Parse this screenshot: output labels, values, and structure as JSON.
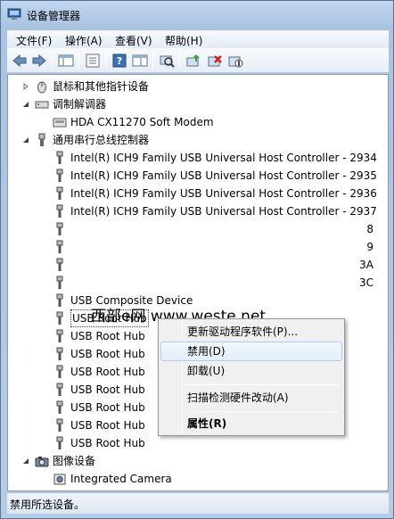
{
  "window": {
    "title": "设备管理器"
  },
  "menu": [
    "文件(F)",
    "操作(A)",
    "查看(V)",
    "帮助(H)"
  ],
  "tree": [
    {
      "label": "鼠标和其他指针设备",
      "expand": "collapsed",
      "indent": 0,
      "icon": "mouse-icon"
    },
    {
      "label": "调制解调器",
      "expand": "expanded",
      "indent": 0,
      "icon": "modem-icon"
    },
    {
      "label": "HDA CX11270 Soft Modem",
      "expand": "none",
      "indent": 1,
      "icon": "modem-device-icon"
    },
    {
      "label": "通用串行总线控制器",
      "expand": "expanded",
      "indent": 0,
      "icon": "usb-controller-icon"
    },
    {
      "label": "Intel(R) ICH9 Family USB Universal Host Controller - 2934",
      "expand": "none",
      "indent": 1,
      "icon": "usb-plug-icon"
    },
    {
      "label": "Intel(R) ICH9 Family USB Universal Host Controller - 2935",
      "expand": "none",
      "indent": 1,
      "icon": "usb-plug-icon"
    },
    {
      "label": "Intel(R) ICH9 Family USB Universal Host Controller - 2936",
      "expand": "none",
      "indent": 1,
      "icon": "usb-plug-icon"
    },
    {
      "label": "Intel(R) ICH9 Family USB Universal Host Controller - 2937",
      "expand": "none",
      "indent": 1,
      "icon": "usb-plug-icon"
    },
    {
      "label": "8",
      "expand": "none",
      "indent": 1,
      "icon": "usb-plug-icon",
      "tail": true
    },
    {
      "label": "9",
      "expand": "none",
      "indent": 1,
      "icon": "usb-plug-icon",
      "tail": true
    },
    {
      "label": "3A",
      "expand": "none",
      "indent": 1,
      "icon": "usb-plug-icon",
      "tail": true
    },
    {
      "label": "3C",
      "expand": "none",
      "indent": 1,
      "icon": "usb-plug-icon",
      "tail": true
    },
    {
      "label": "USB Composite Device",
      "expand": "none",
      "indent": 1,
      "icon": "usb-plug-icon"
    },
    {
      "label": "USB Root Hub",
      "expand": "none",
      "indent": 1,
      "icon": "usb-plug-icon",
      "selected": true
    },
    {
      "label": "USB Root Hub",
      "expand": "none",
      "indent": 1,
      "icon": "usb-plug-icon"
    },
    {
      "label": "USB Root Hub",
      "expand": "none",
      "indent": 1,
      "icon": "usb-plug-icon"
    },
    {
      "label": "USB Root Hub",
      "expand": "none",
      "indent": 1,
      "icon": "usb-plug-icon"
    },
    {
      "label": "USB Root Hub",
      "expand": "none",
      "indent": 1,
      "icon": "usb-plug-icon"
    },
    {
      "label": "USB Root Hub",
      "expand": "none",
      "indent": 1,
      "icon": "usb-plug-icon"
    },
    {
      "label": "USB Root Hub",
      "expand": "none",
      "indent": 1,
      "icon": "usb-plug-icon"
    },
    {
      "label": "USB Root Hub",
      "expand": "none",
      "indent": 1,
      "icon": "usb-plug-icon"
    },
    {
      "label": "图像设备",
      "expand": "expanded",
      "indent": 0,
      "icon": "camera-category-icon"
    },
    {
      "label": "Integrated Camera",
      "expand": "none",
      "indent": 1,
      "icon": "camera-icon"
    }
  ],
  "watermark": "西部e网 www.weste.net",
  "context_menu": {
    "update_driver": "更新驱动程序软件(P)...",
    "disable": "禁用(D)",
    "uninstall": "卸载(U)",
    "scan": "扫描检测硬件改动(A)",
    "properties": "属性(R)"
  },
  "status": "禁用所选设备。"
}
